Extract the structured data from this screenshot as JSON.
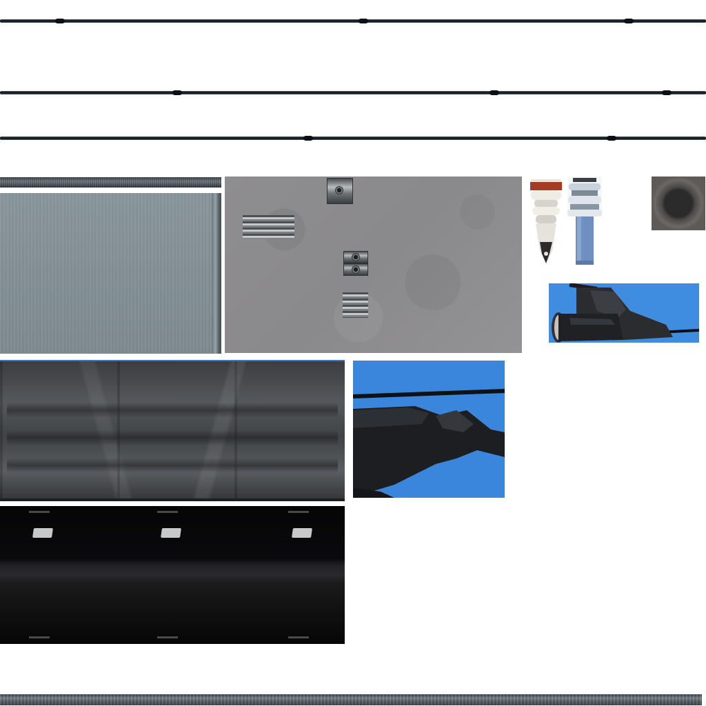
{
  "atlas": {
    "cable_count": 3,
    "palette": {
      "cable": "#0e1418",
      "sky": "#3f8de0",
      "concrete": "#8e8d8f",
      "grey_panel": "#85929a",
      "sheet": "#4a4d50",
      "black_strip": "#0a0a0c",
      "insulator_red": "#a43b24",
      "insulator_blue": "#6f8fc0"
    },
    "icons": [
      "cable-icon",
      "bolt-icon",
      "insulator-icon",
      "cable-sleeve-icon"
    ]
  }
}
